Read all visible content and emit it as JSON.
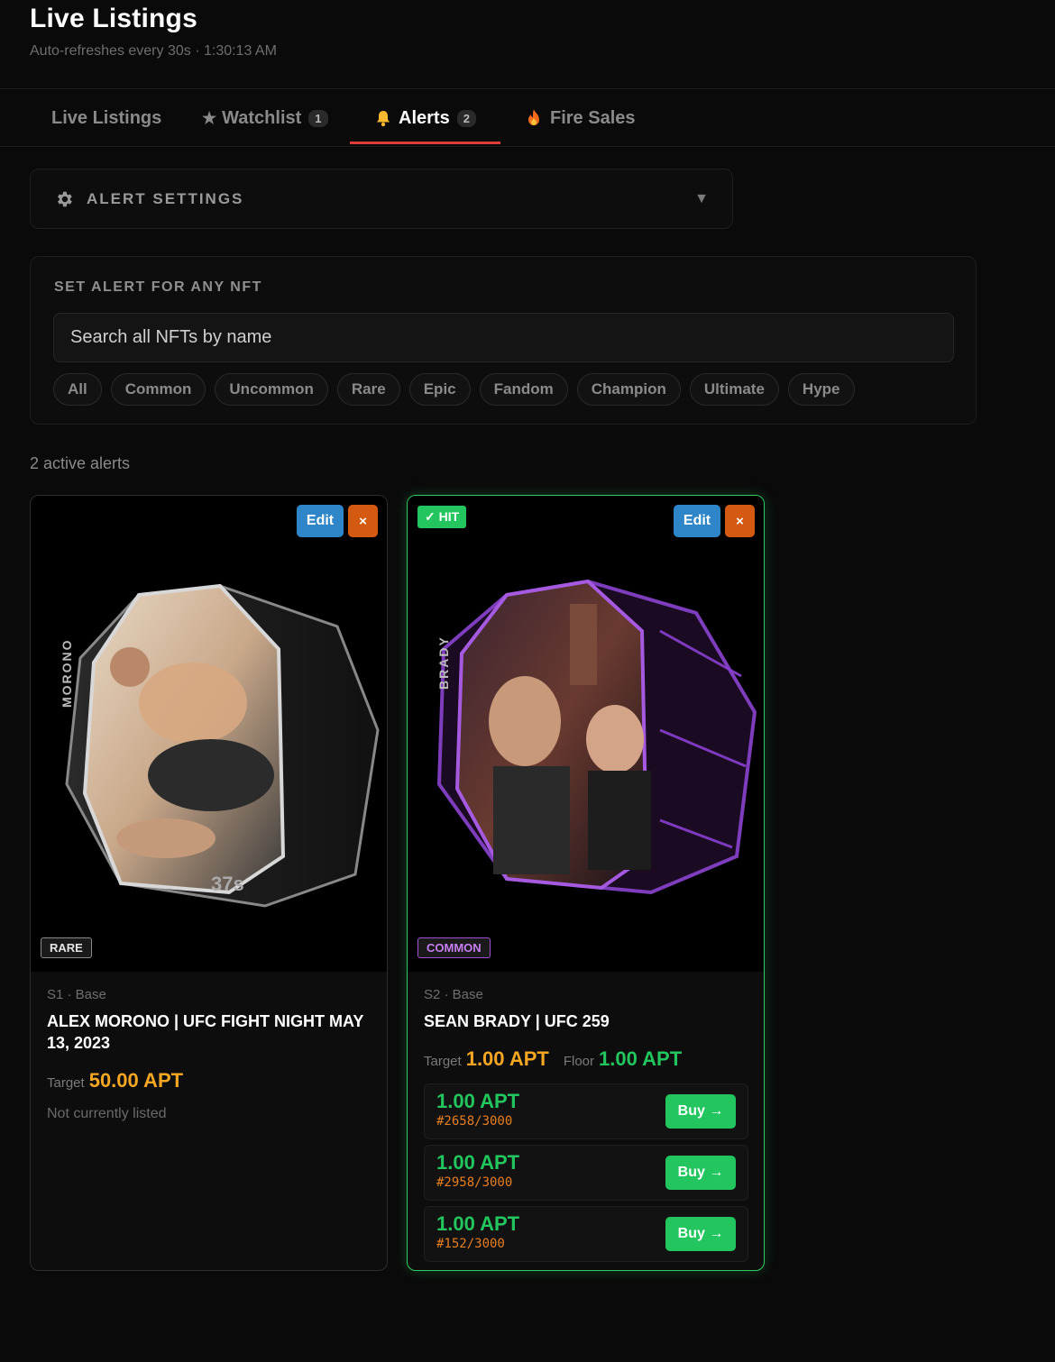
{
  "header": {
    "title": "Live Listings",
    "subtitle": "Auto-refreshes every 30s · 1:30:13 AM"
  },
  "tabs": [
    {
      "label": "Live Listings",
      "icon": ""
    },
    {
      "label": "Watchlist",
      "icon": "star-icon",
      "count": "1"
    },
    {
      "label": "Alerts",
      "icon": "bell-icon",
      "count": "2",
      "active": true
    },
    {
      "label": "Fire Sales",
      "icon": "fire-icon"
    }
  ],
  "settings": {
    "label": "ALERT SETTINGS",
    "icon": "gear-icon",
    "chevron": "▼"
  },
  "alert_panel": {
    "label": "SET ALERT FOR ANY NFT",
    "search_placeholder": "Search all NFTs by name",
    "filters": [
      "All",
      "Common",
      "Uncommon",
      "Rare",
      "Epic",
      "Fandom",
      "Champion",
      "Ultimate",
      "Hype"
    ]
  },
  "active_count": "2 active alerts",
  "cards": [
    {
      "hit": false,
      "edit_label": "Edit",
      "close_label": "×",
      "rarity": "RARE",
      "fighter_vertical": "MORONO",
      "duration": "37s",
      "meta": "S1 · Base",
      "name": "ALEX MORONO | UFC FIGHT NIGHT MAY 13, 2023",
      "target_label": "Target",
      "target_value": "50.00 APT",
      "status": "Not currently listed"
    },
    {
      "hit": true,
      "hit_label": "✓ HIT",
      "edit_label": "Edit",
      "close_label": "×",
      "rarity": "COMMON",
      "fighter_vertical": "BRADY",
      "meta": "S2 · Base",
      "name": "SEAN BRADY | UFC 259",
      "target_label": "Target",
      "target_value": "1.00 APT",
      "floor_label": "Floor",
      "floor_value": "1.00 APT",
      "listings": [
        {
          "price": "1.00 APT",
          "serial": "#2658/3000",
          "buy": "Buy →"
        },
        {
          "price": "1.00 APT",
          "serial": "#2958/3000",
          "buy": "Buy →"
        },
        {
          "price": "1.00 APT",
          "serial": "#152/3000",
          "buy": "Buy →"
        }
      ]
    }
  ],
  "colors": {
    "accent_tab": "#e03b3b",
    "target": "#f5a623",
    "floor": "#22c55e",
    "edit": "#2e86c9",
    "close": "#d45a12"
  }
}
